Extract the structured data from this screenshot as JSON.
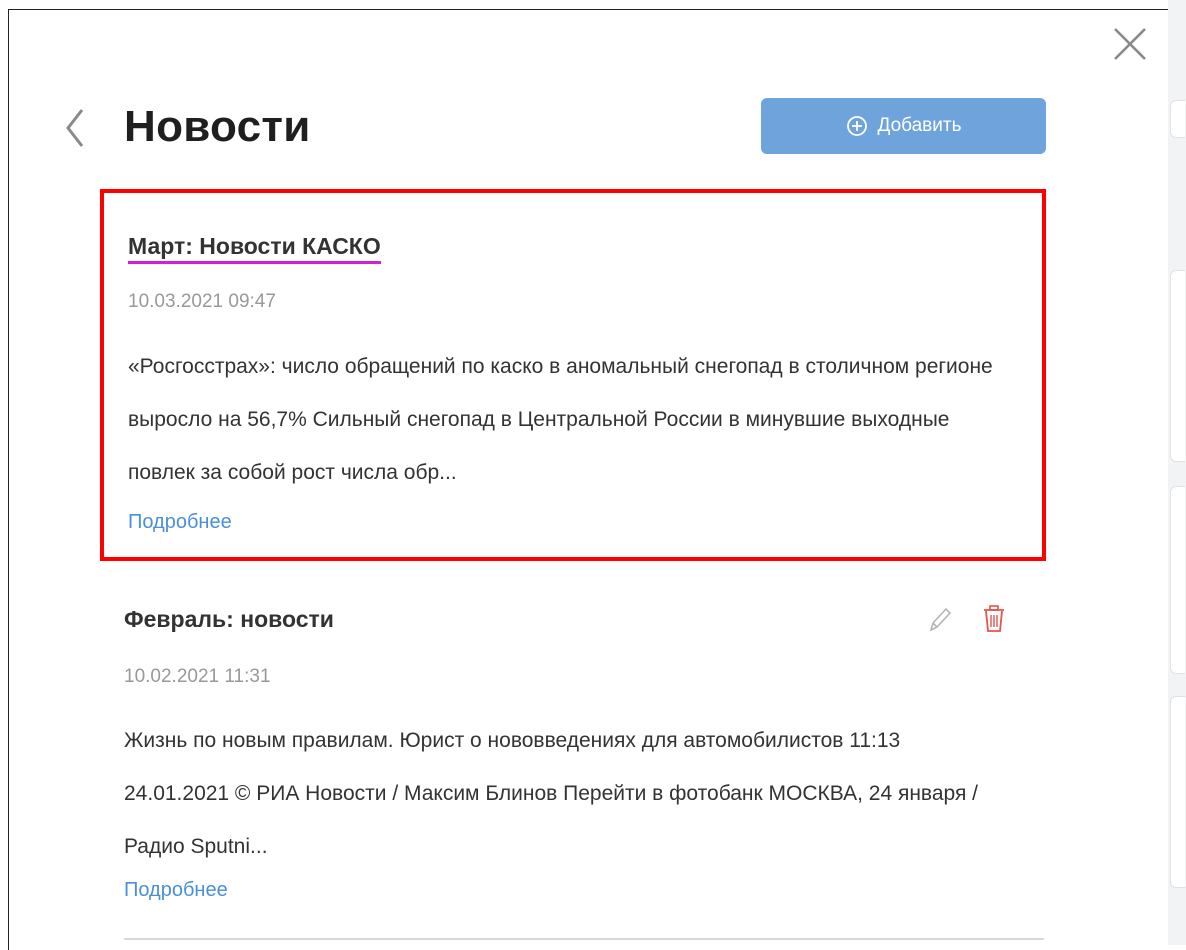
{
  "top_stub": "",
  "header": {
    "title": "Новости",
    "add_button_label": "Добавить"
  },
  "news": [
    {
      "title": "Март: Новости КАСКО",
      "date": "10.03.2021 09:47",
      "text": "«Росгосстрах»: число обращений по каско в аномальный снегопад в столичном регионе выросло на 56,7% Сильный снегопад в Центральной России в минувшие выходные повлек за собой рост числа обр...",
      "more": "Подробнее"
    },
    {
      "title": "Февраль: новости",
      "date": "10.02.2021 11:31",
      "text": "Жизнь по новым правилам. Юрист о нововведениях для автомобилистов 11:13 24.01.2021   © РИА Новости / Максим Блинов Перейти в фотобанк МОСКВА, 24 января / Радио Sputni...",
      "more": "Подробнее"
    }
  ],
  "colors": {
    "accent_button": "#6fa3dc",
    "link": "#4a90d9",
    "highlight_border": "#ff0000",
    "title_underline": "#d21fd8",
    "delete_icon": "#e5534b"
  },
  "icons": {
    "close": "close-icon",
    "back": "chevron-left-icon",
    "add": "plus-circle-icon",
    "edit": "pencil-icon",
    "delete": "trash-icon"
  }
}
